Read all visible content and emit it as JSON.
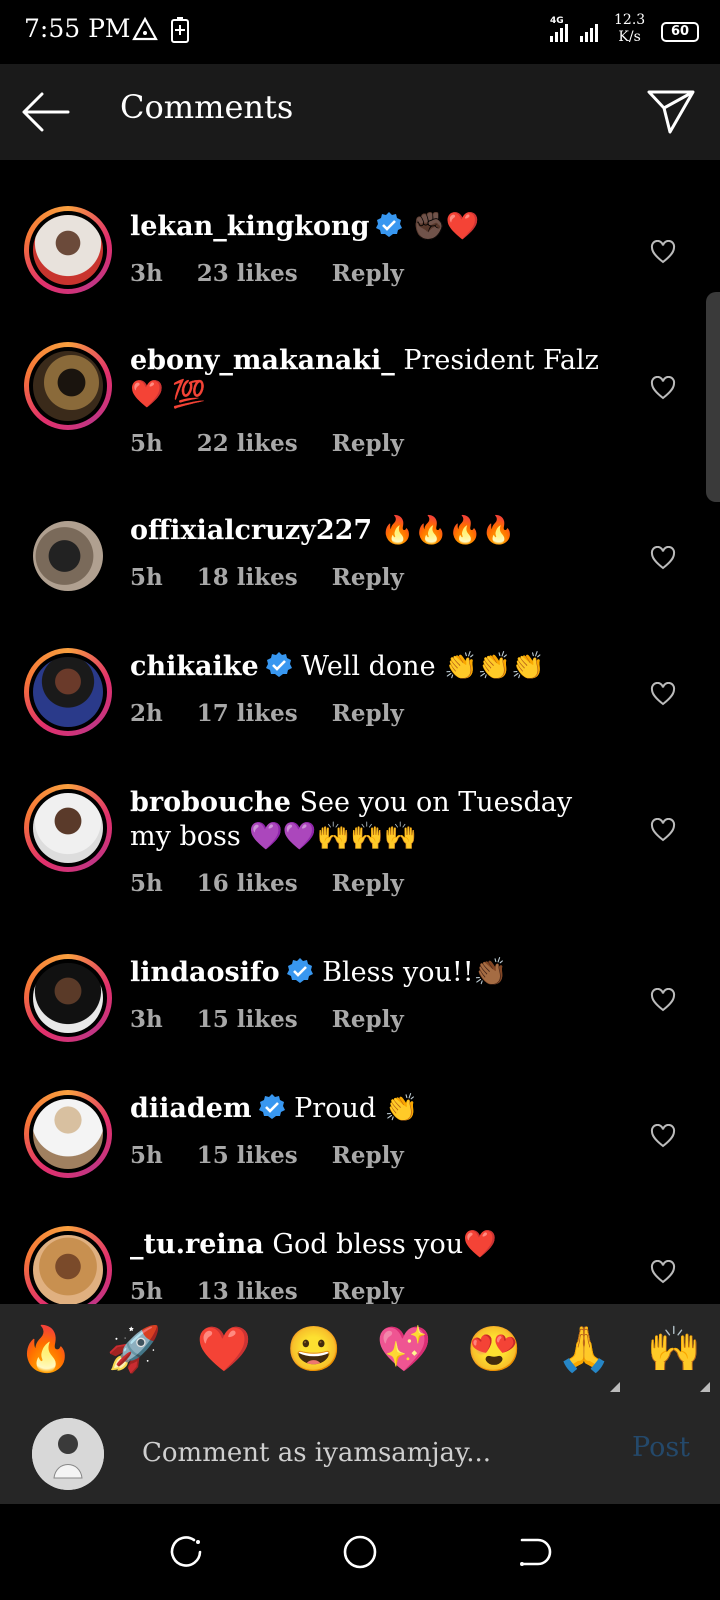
{
  "status_bar": {
    "time": "7:55 PM",
    "network": "4G",
    "speed_value": "12.3",
    "speed_unit": "K/s",
    "battery": "60"
  },
  "header": {
    "title": "Comments",
    "back_icon": "arrow-left-icon",
    "share_icon": "paper-plane-icon"
  },
  "comments": [
    {
      "username": "lekan_kingkong",
      "verified": true,
      "text": "✊🏿❤️",
      "time": "3h",
      "likes": "23 likes",
      "reply": "Reply"
    },
    {
      "username": "ebony_makanaki_",
      "verified": false,
      "text": "President Falz ❤️ 💯",
      "time": "5h",
      "likes": "22 likes",
      "reply": "Reply"
    },
    {
      "username": "offixialcruzy227",
      "verified": false,
      "text": "🔥🔥🔥🔥",
      "time": "5h",
      "likes": "18 likes",
      "reply": "Reply"
    },
    {
      "username": "chikaike",
      "verified": true,
      "text": "Well done 👏👏👏",
      "time": "2h",
      "likes": "17 likes",
      "reply": "Reply"
    },
    {
      "username": "brobouche",
      "verified": false,
      "text": "See you on Tuesday my boss 💜💜🙌🙌🙌",
      "time": "5h",
      "likes": "16 likes",
      "reply": "Reply"
    },
    {
      "username": "lindaosifo",
      "verified": true,
      "text": "Bless you!!👏🏾",
      "time": "3h",
      "likes": "15 likes",
      "reply": "Reply"
    },
    {
      "username": "diiadem",
      "verified": true,
      "text": "Proud 👏",
      "time": "5h",
      "likes": "15 likes",
      "reply": "Reply"
    },
    {
      "username": "_tu.reina",
      "verified": false,
      "text": "God bless you❤️",
      "time": "5h",
      "likes": "13 likes",
      "reply": "Reply"
    }
  ],
  "emoji_bar": [
    "🔥",
    "🚀",
    "❤️",
    "😀",
    "💖",
    "😍",
    "🙏",
    "🙌"
  ],
  "comment_input": {
    "placeholder": "Comment as iyamsamjay...",
    "post_label": "Post"
  },
  "nav_bar": [
    "recent-apps-icon",
    "home-icon",
    "back-icon"
  ],
  "colors": {
    "background": "#000000",
    "header": "#1a1a1a",
    "bar": "#262626",
    "meta_text": "#a8a8a8",
    "verified_blue": "#3897f0",
    "post_disabled": "#24496b"
  }
}
